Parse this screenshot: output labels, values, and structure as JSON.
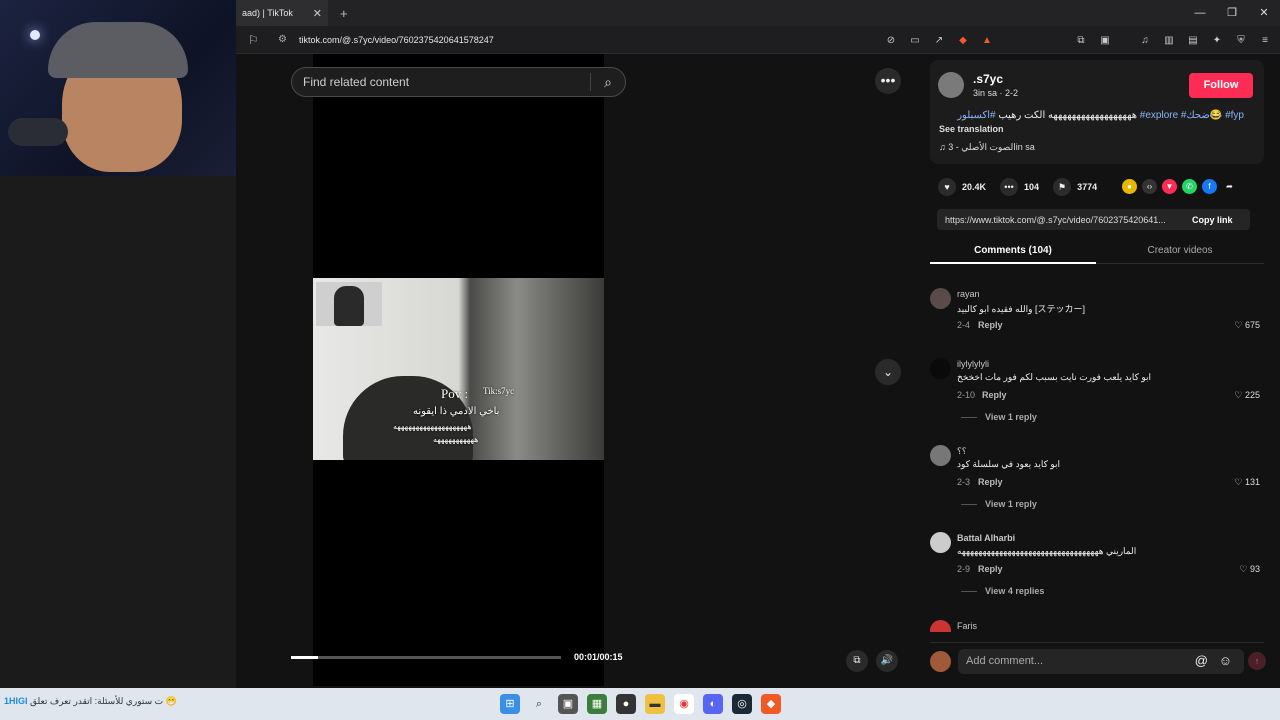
{
  "browser": {
    "tab_title": "aad) | TikTok",
    "url": "tiktok.com/@.s7yc/video/7602375420641578247"
  },
  "video": {
    "search_placeholder": "Find related content",
    "overlay": {
      "pov": "Pov :",
      "watermark": "Tik:s7yc",
      "line1": "باخي الادمي ذا ايقونه",
      "line2": "ههههههههههههههههههههه",
      "line3": "هههههههههههه"
    },
    "time": "00:01/00:15",
    "progress_fraction": 0.1
  },
  "post": {
    "username": ".s7yc",
    "subtitle": "3in sa · 2-2",
    "description_text": "ههههههههههههههههههه الكت رهيب ",
    "tags": [
      "#اكسبلور",
      "#explore",
      "#ضحك😂",
      "#fyp"
    ],
    "see_translation": "See translation",
    "music": "الصوت الأصلي - 3in sa",
    "follow_label": "Follow",
    "likes": "20.4K",
    "comments_count": "104",
    "saves": "3774",
    "link": "https://www.tiktok.com/@.s7yc/video/7602375420641...",
    "copy_link": "Copy link",
    "tab_comments": "Comments (104)",
    "tab_creator": "Creator videos"
  },
  "comments": [
    {
      "name": "rayan",
      "text": "والله فقيده ابو كالبيد [ステッカー]",
      "date": "2-4",
      "reply": "Reply",
      "likes": "675"
    },
    {
      "name": "ilylylylyli",
      "text": "ابو كايد يلعب فورت نايت بسبب لكم فور مات اخخخخ",
      "date": "2-10",
      "reply": "Reply",
      "likes": "225",
      "view_replies": "View 1 reply"
    },
    {
      "name": "؟؟",
      "text": "ابو كايد يعود في سلسلة كود",
      "date": "2-3",
      "reply": "Reply",
      "likes": "131",
      "view_replies": "View 1 reply"
    },
    {
      "name": "Battal Alharbi",
      "text": "الماريني ههههههههههههههههههههههههههههههههههه",
      "date": "2-9",
      "reply": "Reply",
      "likes": "93",
      "view_replies": "View 4 replies"
    },
    {
      "name": "Faris",
      "text": "",
      "date": "",
      "reply": "",
      "likes": ""
    }
  ],
  "add_comment_placeholder": "Add comment...",
  "taskbar": {
    "left_text": "1HIGI",
    "left_extra": "ت ستوري للأسئلة: اتقدر تعرف تعلق 😁"
  },
  "colors": {
    "follow": "#fe2c55",
    "tag": "#8ab4f8",
    "background": "#121212"
  }
}
